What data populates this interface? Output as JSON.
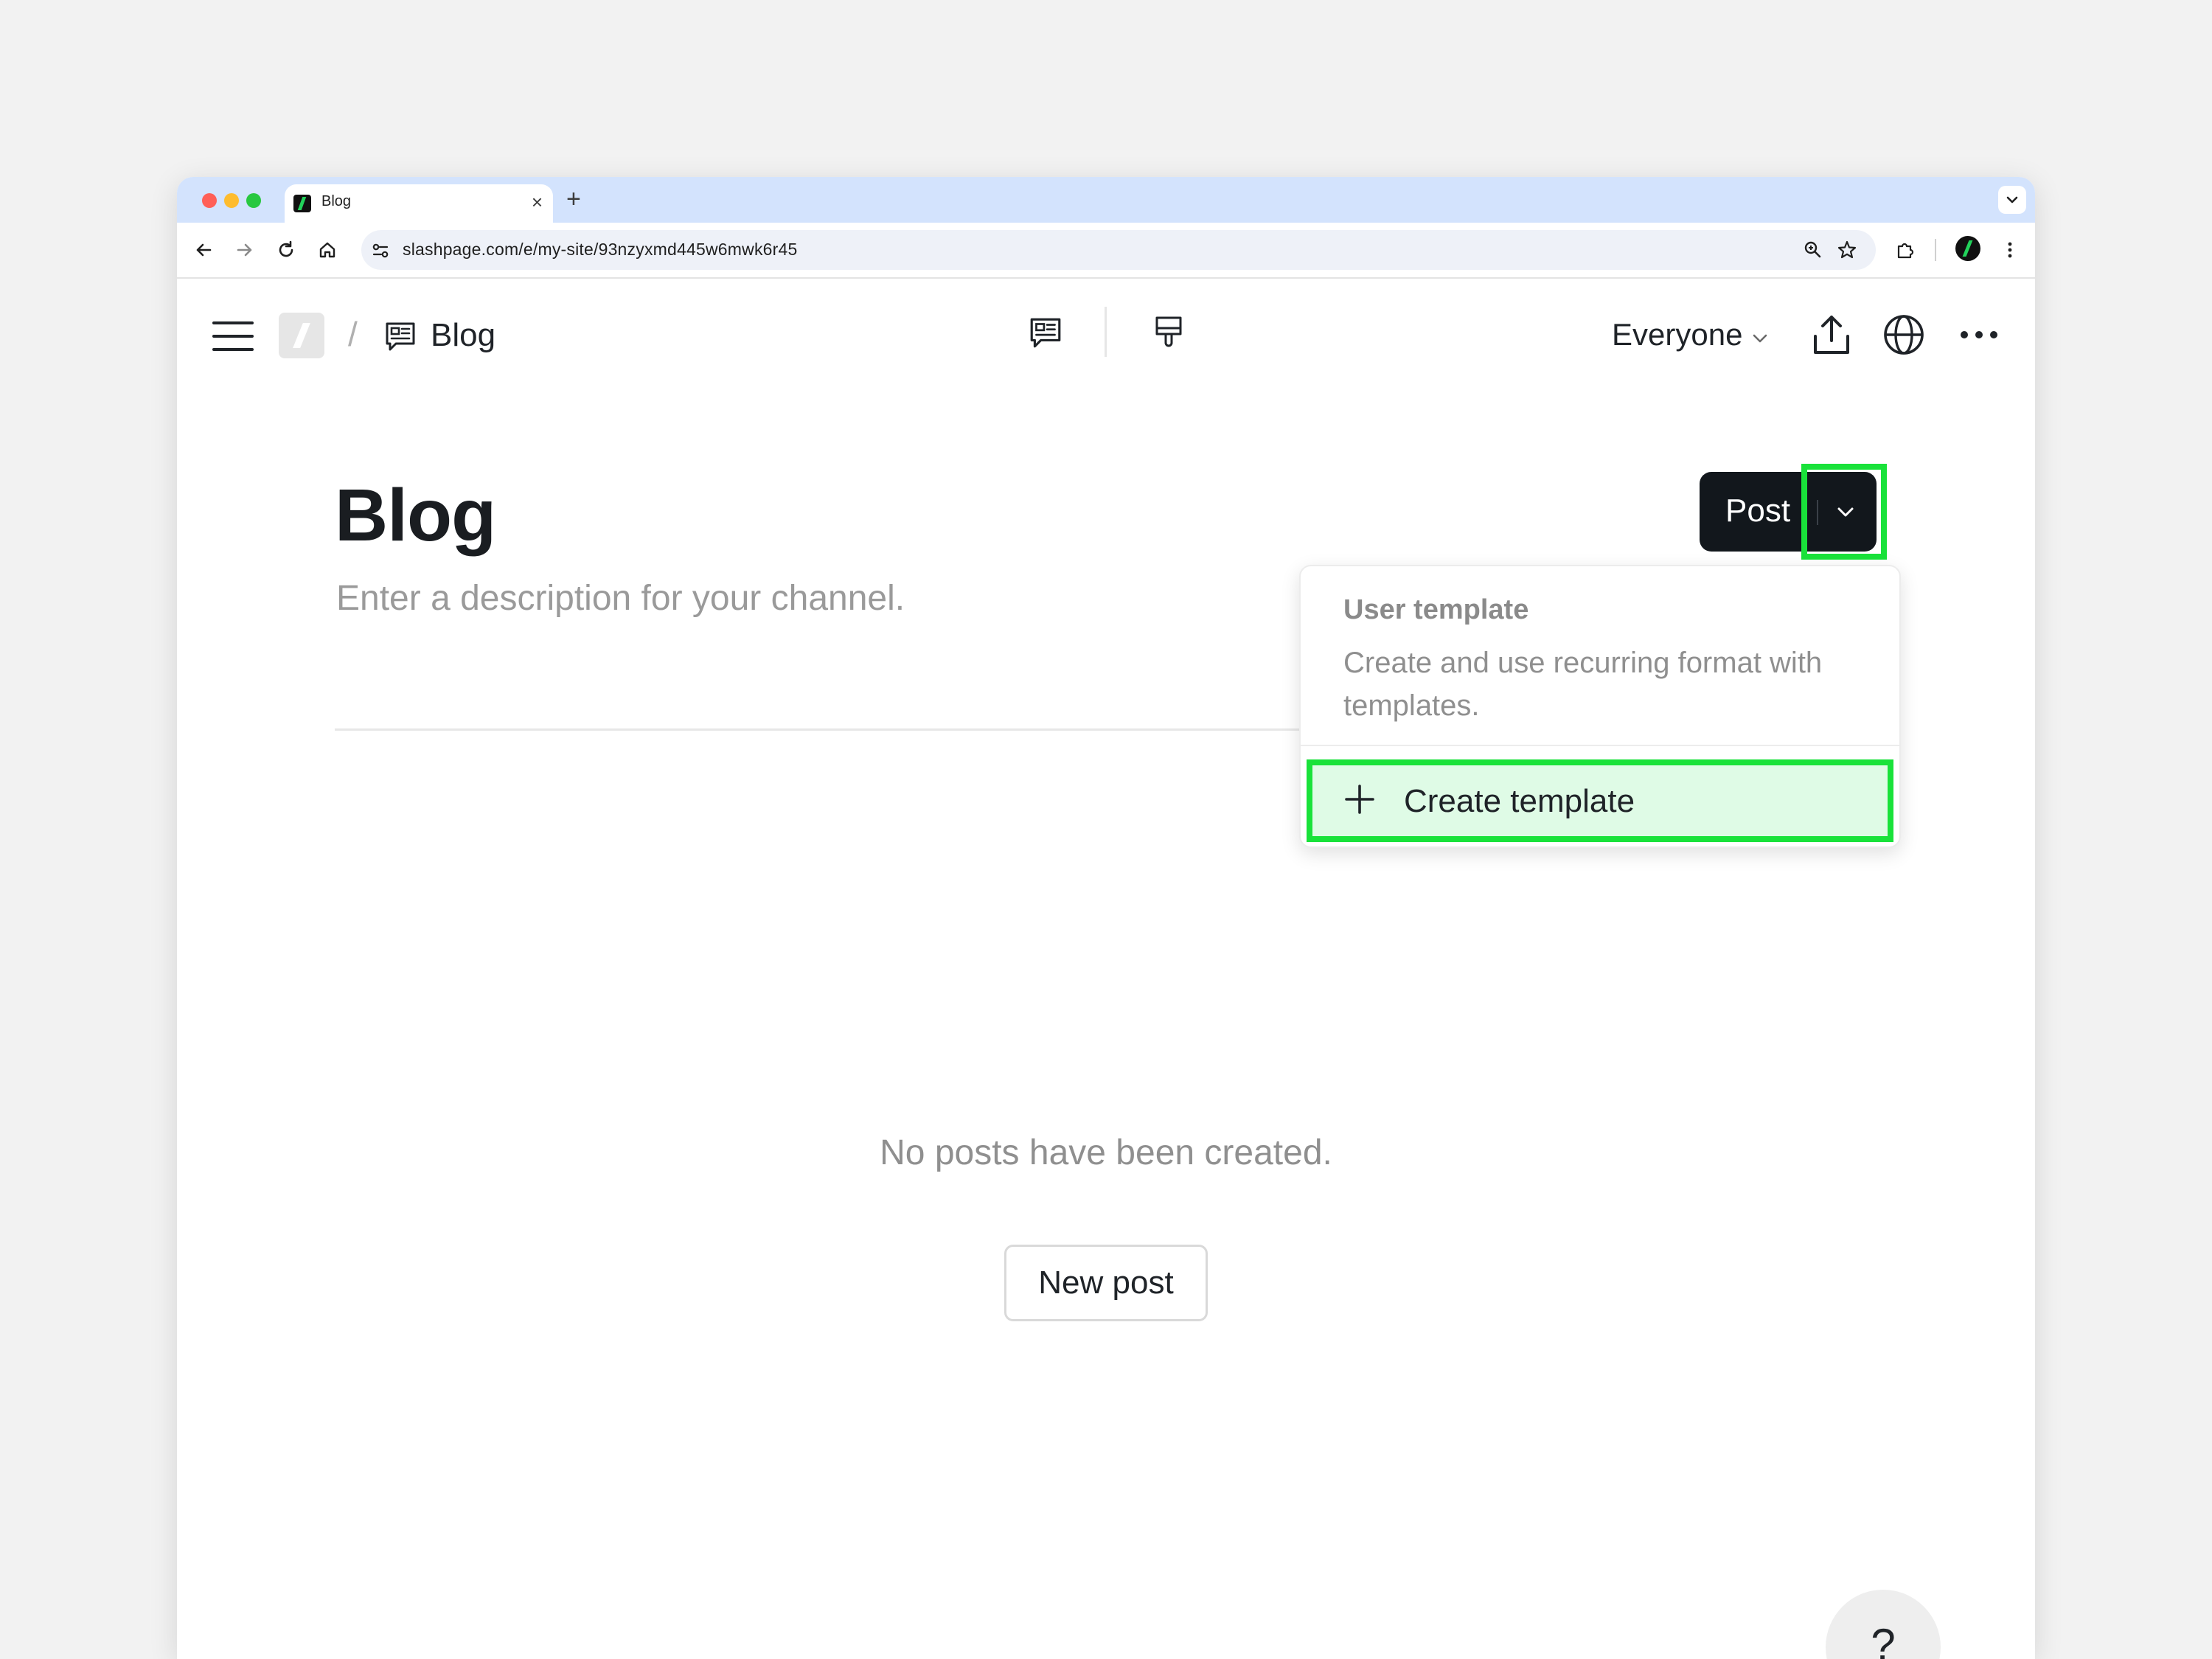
{
  "browser": {
    "tab_title": "Blog",
    "tab_close": "×",
    "new_tab": "+",
    "url": "slashpage.com/e/my-site/93nzyxmd445w6mwk6r45"
  },
  "header": {
    "breadcrumb_separator": "/",
    "channel_title": "Blog",
    "audience_label": "Everyone"
  },
  "main": {
    "title": "Blog",
    "description_placeholder": "Enter a description for your channel.",
    "post_button_label": "Post",
    "empty_state": "No posts have been created.",
    "new_post_label": "New post"
  },
  "dropdown": {
    "section_title": "User template",
    "section_description": "Create and use recurring format with templates.",
    "create_label": "Create template"
  },
  "help": {
    "label": "?"
  },
  "colors": {
    "highlight": "#19e23a",
    "highlight_fill": "#dffbe6",
    "post_button": "#12171c"
  }
}
